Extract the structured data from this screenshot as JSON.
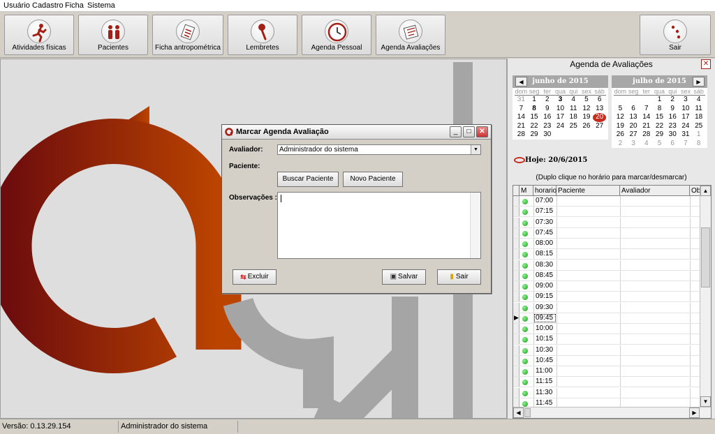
{
  "menu": [
    "Usuário",
    "Cadastro",
    "Ficha",
    "Sistema"
  ],
  "toolbar": {
    "buttons": [
      {
        "label": "Atividades físicas",
        "icon": "running-person-icon"
      },
      {
        "label": "Pacientes",
        "icon": "people-icon"
      },
      {
        "label": "Ficha antropométrica",
        "icon": "clipboard-icon"
      },
      {
        "label": "Lembretes",
        "icon": "pushpin-icon"
      },
      {
        "label": "Agenda Pessoal",
        "icon": "clock-icon"
      },
      {
        "label": "Agenda Avaliações",
        "icon": "appointment-book-icon"
      }
    ],
    "exit_label": "Sair"
  },
  "logo": {
    "letters": "ágil",
    "accent_color": "#b23b0c",
    "gray_color": "#9a9a9a"
  },
  "dialog": {
    "title": "Marcar Agenda Avaliação",
    "avaliador_label": "Avaliador:",
    "avaliador_value": "Administrador do sistema",
    "paciente_label": "Paciente:",
    "buscar_label": "Buscar Paciente",
    "novo_label": "Novo Paciente",
    "obs_label": "Observações :",
    "excluir_label": "Excluir",
    "salvar_label": "Salvar",
    "sair_label": "Sair"
  },
  "panel": {
    "title": "Agenda de Avaliações",
    "cal1": {
      "title": "junho de 2015",
      "weekdays": [
        "dom",
        "seg",
        "ter",
        "qua",
        "qui",
        "sex",
        "sáb"
      ],
      "days": [
        "31",
        "1",
        "2",
        "3",
        "4",
        "5",
        "6",
        "7",
        "8",
        "9",
        "10",
        "11",
        "12",
        "13",
        "14",
        "15",
        "16",
        "17",
        "18",
        "19",
        "20",
        "21",
        "22",
        "23",
        "24",
        "25",
        "26",
        "27",
        "28",
        "29",
        "30"
      ],
      "other_month": [
        "31"
      ],
      "bold": [
        "3",
        "8"
      ],
      "today": "20"
    },
    "cal2": {
      "title": "julho de 2015",
      "weekdays": [
        "dom",
        "seg",
        "ter",
        "qua",
        "qui",
        "sex",
        "sáb"
      ],
      "days": [
        "",
        "",
        "",
        "1",
        "2",
        "3",
        "4",
        "5",
        "6",
        "7",
        "8",
        "9",
        "10",
        "11",
        "12",
        "13",
        "14",
        "15",
        "16",
        "17",
        "18",
        "19",
        "20",
        "21",
        "22",
        "23",
        "24",
        "25",
        "26",
        "27",
        "28",
        "29",
        "30",
        "31",
        "1",
        "2",
        "3",
        "4",
        "5",
        "6",
        "7",
        "8"
      ],
      "other_start_index": 34
    },
    "today_label": "Hoje: 20/6/2015",
    "hint": "(Duplo clique no horário para marcar/desmarcar)",
    "columns": [
      "M",
      "horario",
      "Paciente",
      "Avaliador",
      "Obse"
    ],
    "times": [
      "07:00",
      "07:15",
      "07:30",
      "07:45",
      "08:00",
      "08:15",
      "08:30",
      "08:45",
      "09:00",
      "09:15",
      "09:30",
      "09:45",
      "10:00",
      "10:15",
      "10:30",
      "10:45",
      "11:00",
      "11:15",
      "11:30",
      "11:45"
    ],
    "selected_time": "09:45"
  },
  "status": {
    "version": "Versão: 0.13.29.154",
    "user": "Administrador do sistema"
  }
}
